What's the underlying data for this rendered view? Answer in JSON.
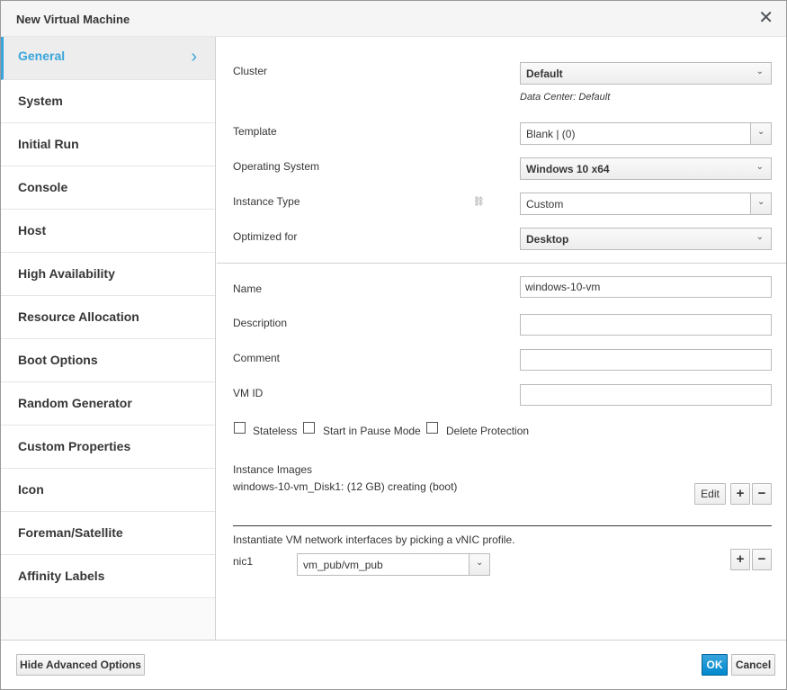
{
  "dialog": {
    "title": "New Virtual Machine",
    "close_icon": "close-icon"
  },
  "sidebar": {
    "items": [
      {
        "label": "General",
        "active": true
      },
      {
        "label": "System"
      },
      {
        "label": "Initial Run"
      },
      {
        "label": "Console"
      },
      {
        "label": "Host"
      },
      {
        "label": "High Availability"
      },
      {
        "label": "Resource Allocation"
      },
      {
        "label": "Boot Options"
      },
      {
        "label": "Random Generator"
      },
      {
        "label": "Custom Properties"
      },
      {
        "label": "Icon"
      },
      {
        "label": "Foreman/Satellite"
      },
      {
        "label": "Affinity Labels"
      }
    ]
  },
  "general": {
    "cluster": {
      "label": "Cluster",
      "value": "Default",
      "note": "Data Center: Default"
    },
    "template": {
      "label": "Template",
      "value": "Blank |  (0)"
    },
    "os": {
      "label": "Operating System",
      "value": "Windows 10 x64"
    },
    "instance_type": {
      "label": "Instance Type",
      "value": "Custom"
    },
    "optimized": {
      "label": "Optimized for",
      "value": "Desktop"
    },
    "name": {
      "label": "Name",
      "value": "windows-10-vm"
    },
    "description": {
      "label": "Description",
      "value": ""
    },
    "comment": {
      "label": "Comment",
      "value": ""
    },
    "vm_id": {
      "label": "VM ID",
      "value": ""
    },
    "checkboxes": {
      "stateless": "Stateless",
      "pause": "Start in Pause Mode",
      "delete_protection": "Delete Protection"
    },
    "instance_images": {
      "label": "Instance Images",
      "disk": "windows-10-vm_Disk1: (12 GB) creating (boot)",
      "edit": "Edit",
      "plus": "+",
      "minus": "−"
    },
    "network": {
      "hint": "Instantiate VM network interfaces by picking a vNIC profile.",
      "nic_label": "nic1",
      "nic_value": "vm_pub/vm_pub",
      "plus": "+",
      "minus": "−"
    }
  },
  "footer": {
    "advanced": "Hide Advanced Options",
    "ok": "OK",
    "cancel": "Cancel"
  },
  "colors": {
    "accent": "#39a5dc",
    "primary": "#0088ce"
  }
}
